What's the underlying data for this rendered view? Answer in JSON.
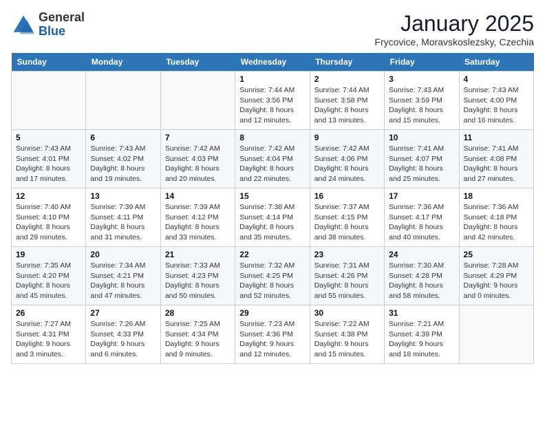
{
  "header": {
    "logo_general": "General",
    "logo_blue": "Blue",
    "title": "January 2025",
    "subtitle": "Frycovice, Moravskoslezsky, Czechia"
  },
  "days_of_week": [
    "Sunday",
    "Monday",
    "Tuesday",
    "Wednesday",
    "Thursday",
    "Friday",
    "Saturday"
  ],
  "weeks": [
    [
      {
        "day": "",
        "info": ""
      },
      {
        "day": "",
        "info": ""
      },
      {
        "day": "",
        "info": ""
      },
      {
        "day": "1",
        "info": "Sunrise: 7:44 AM\nSunset: 3:56 PM\nDaylight: 8 hours\nand 12 minutes."
      },
      {
        "day": "2",
        "info": "Sunrise: 7:44 AM\nSunset: 3:58 PM\nDaylight: 8 hours\nand 13 minutes."
      },
      {
        "day": "3",
        "info": "Sunrise: 7:43 AM\nSunset: 3:59 PM\nDaylight: 8 hours\nand 15 minutes."
      },
      {
        "day": "4",
        "info": "Sunrise: 7:43 AM\nSunset: 4:00 PM\nDaylight: 8 hours\nand 16 minutes."
      }
    ],
    [
      {
        "day": "5",
        "info": "Sunrise: 7:43 AM\nSunset: 4:01 PM\nDaylight: 8 hours\nand 17 minutes."
      },
      {
        "day": "6",
        "info": "Sunrise: 7:43 AM\nSunset: 4:02 PM\nDaylight: 8 hours\nand 19 minutes."
      },
      {
        "day": "7",
        "info": "Sunrise: 7:42 AM\nSunset: 4:03 PM\nDaylight: 8 hours\nand 20 minutes."
      },
      {
        "day": "8",
        "info": "Sunrise: 7:42 AM\nSunset: 4:04 PM\nDaylight: 8 hours\nand 22 minutes."
      },
      {
        "day": "9",
        "info": "Sunrise: 7:42 AM\nSunset: 4:06 PM\nDaylight: 8 hours\nand 24 minutes."
      },
      {
        "day": "10",
        "info": "Sunrise: 7:41 AM\nSunset: 4:07 PM\nDaylight: 8 hours\nand 25 minutes."
      },
      {
        "day": "11",
        "info": "Sunrise: 7:41 AM\nSunset: 4:08 PM\nDaylight: 8 hours\nand 27 minutes."
      }
    ],
    [
      {
        "day": "12",
        "info": "Sunrise: 7:40 AM\nSunset: 4:10 PM\nDaylight: 8 hours\nand 29 minutes."
      },
      {
        "day": "13",
        "info": "Sunrise: 7:39 AM\nSunset: 4:11 PM\nDaylight: 8 hours\nand 31 minutes."
      },
      {
        "day": "14",
        "info": "Sunrise: 7:39 AM\nSunset: 4:12 PM\nDaylight: 8 hours\nand 33 minutes."
      },
      {
        "day": "15",
        "info": "Sunrise: 7:38 AM\nSunset: 4:14 PM\nDaylight: 8 hours\nand 35 minutes."
      },
      {
        "day": "16",
        "info": "Sunrise: 7:37 AM\nSunset: 4:15 PM\nDaylight: 8 hours\nand 38 minutes."
      },
      {
        "day": "17",
        "info": "Sunrise: 7:36 AM\nSunset: 4:17 PM\nDaylight: 8 hours\nand 40 minutes."
      },
      {
        "day": "18",
        "info": "Sunrise: 7:36 AM\nSunset: 4:18 PM\nDaylight: 8 hours\nand 42 minutes."
      }
    ],
    [
      {
        "day": "19",
        "info": "Sunrise: 7:35 AM\nSunset: 4:20 PM\nDaylight: 8 hours\nand 45 minutes."
      },
      {
        "day": "20",
        "info": "Sunrise: 7:34 AM\nSunset: 4:21 PM\nDaylight: 8 hours\nand 47 minutes."
      },
      {
        "day": "21",
        "info": "Sunrise: 7:33 AM\nSunset: 4:23 PM\nDaylight: 8 hours\nand 50 minutes."
      },
      {
        "day": "22",
        "info": "Sunrise: 7:32 AM\nSunset: 4:25 PM\nDaylight: 8 hours\nand 52 minutes."
      },
      {
        "day": "23",
        "info": "Sunrise: 7:31 AM\nSunset: 4:26 PM\nDaylight: 8 hours\nand 55 minutes."
      },
      {
        "day": "24",
        "info": "Sunrise: 7:30 AM\nSunset: 4:28 PM\nDaylight: 8 hours\nand 58 minutes."
      },
      {
        "day": "25",
        "info": "Sunrise: 7:28 AM\nSunset: 4:29 PM\nDaylight: 9 hours\nand 0 minutes."
      }
    ],
    [
      {
        "day": "26",
        "info": "Sunrise: 7:27 AM\nSunset: 4:31 PM\nDaylight: 9 hours\nand 3 minutes."
      },
      {
        "day": "27",
        "info": "Sunrise: 7:26 AM\nSunset: 4:33 PM\nDaylight: 9 hours\nand 6 minutes."
      },
      {
        "day": "28",
        "info": "Sunrise: 7:25 AM\nSunset: 4:34 PM\nDaylight: 9 hours\nand 9 minutes."
      },
      {
        "day": "29",
        "info": "Sunrise: 7:23 AM\nSunset: 4:36 PM\nDaylight: 9 hours\nand 12 minutes."
      },
      {
        "day": "30",
        "info": "Sunrise: 7:22 AM\nSunset: 4:38 PM\nDaylight: 9 hours\nand 15 minutes."
      },
      {
        "day": "31",
        "info": "Sunrise: 7:21 AM\nSunset: 4:39 PM\nDaylight: 9 hours\nand 18 minutes."
      },
      {
        "day": "",
        "info": ""
      }
    ]
  ]
}
